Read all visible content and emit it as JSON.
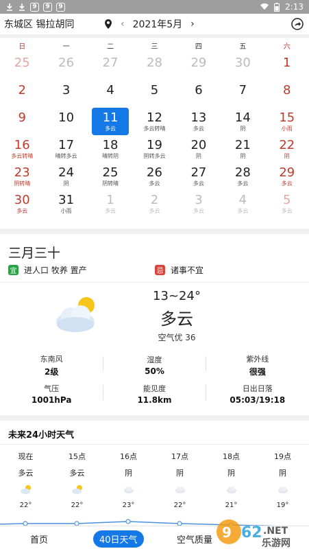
{
  "status_bar": {
    "time": "2:13",
    "badges": [
      "9",
      "9",
      "9"
    ],
    "icons": [
      "download-icon",
      "download-icon",
      "wifi-icon",
      "battery-icon"
    ]
  },
  "header": {
    "location": "东城区 锡拉胡同",
    "month": "2021年5月",
    "prev_icon": "chevron-left-icon",
    "next_icon": "chevron-right-icon",
    "share_icon": "share-icon"
  },
  "calendar": {
    "weekdays": [
      "日",
      "一",
      "二",
      "三",
      "四",
      "五",
      "六"
    ],
    "weeks": [
      [
        {
          "num": "25",
          "sub": "",
          "muted": true,
          "red": true
        },
        {
          "num": "26",
          "sub": "",
          "muted": true
        },
        {
          "num": "27",
          "sub": "",
          "muted": true
        },
        {
          "num": "28",
          "sub": "",
          "muted": true
        },
        {
          "num": "29",
          "sub": "",
          "muted": true
        },
        {
          "num": "30",
          "sub": "",
          "muted": true
        },
        {
          "num": "1",
          "sub": "",
          "red": true
        }
      ],
      [
        {
          "num": "2",
          "sub": "",
          "red": true
        },
        {
          "num": "3",
          "sub": ""
        },
        {
          "num": "4",
          "sub": ""
        },
        {
          "num": "5",
          "sub": ""
        },
        {
          "num": "6",
          "sub": ""
        },
        {
          "num": "7",
          "sub": ""
        },
        {
          "num": "8",
          "sub": "",
          "red": true
        }
      ],
      [
        {
          "num": "9",
          "sub": "",
          "red": true
        },
        {
          "num": "10",
          "sub": ""
        },
        {
          "num": "11",
          "sub": "多云",
          "selected": true
        },
        {
          "num": "12",
          "sub": "多云转晴"
        },
        {
          "num": "13",
          "sub": "多云"
        },
        {
          "num": "14",
          "sub": "阴"
        },
        {
          "num": "15",
          "sub": "小雨",
          "red": true
        }
      ],
      [
        {
          "num": "16",
          "sub": "多云转晴",
          "red": true
        },
        {
          "num": "17",
          "sub": "晴转多云"
        },
        {
          "num": "18",
          "sub": "晴转阴"
        },
        {
          "num": "19",
          "sub": "阴转多云"
        },
        {
          "num": "20",
          "sub": "阴"
        },
        {
          "num": "21",
          "sub": "阴"
        },
        {
          "num": "22",
          "sub": "阴",
          "red": true
        }
      ],
      [
        {
          "num": "23",
          "sub": "阴转晴",
          "red": true
        },
        {
          "num": "24",
          "sub": "阴"
        },
        {
          "num": "25",
          "sub": "阴转晴"
        },
        {
          "num": "26",
          "sub": "多云"
        },
        {
          "num": "27",
          "sub": "多云"
        },
        {
          "num": "28",
          "sub": "多云"
        },
        {
          "num": "29",
          "sub": "多云",
          "red": true
        }
      ],
      [
        {
          "num": "30",
          "sub": "多云",
          "red": true
        },
        {
          "num": "31",
          "sub": "小雨"
        },
        {
          "num": "1",
          "sub": "多云",
          "muted": true
        },
        {
          "num": "2",
          "sub": "多云",
          "muted": true
        },
        {
          "num": "3",
          "sub": "多云",
          "muted": true
        },
        {
          "num": "4",
          "sub": "多云",
          "muted": true
        },
        {
          "num": "5",
          "sub": "多云",
          "muted": true,
          "red": true
        }
      ]
    ]
  },
  "day_info": {
    "lunar_date": "三月三十",
    "yi_tag": "宜",
    "yi_text": "进人口 牧养 置产",
    "ji_tag": "忌",
    "ji_text": "诸事不宜",
    "temp_range": "13~24°",
    "condition": "多云",
    "air_quality": "空气优 36",
    "metrics": [
      {
        "label": "东南风",
        "value": "2级"
      },
      {
        "label": "湿度",
        "value": "50%"
      },
      {
        "label": "紫外线",
        "value": "很强"
      },
      {
        "label": "气压",
        "value": "1001hPa"
      },
      {
        "label": "能见度",
        "value": "11.8km"
      },
      {
        "label": "日出日落",
        "value": "05:03/19:18"
      }
    ]
  },
  "hourly": {
    "title": "未来24小时天气",
    "hours": [
      {
        "time": "现在",
        "cond": "多云",
        "icon": "partly-cloudy-icon",
        "temp": "22°"
      },
      {
        "time": "15点",
        "cond": "多云",
        "icon": "partly-cloudy-icon",
        "temp": "22°"
      },
      {
        "time": "16点",
        "cond": "阴",
        "icon": "cloud-icon",
        "temp": "23°"
      },
      {
        "time": "17点",
        "cond": "阴",
        "icon": "cloud-icon",
        "temp": "22°"
      },
      {
        "time": "18点",
        "cond": "阴",
        "icon": "cloud-icon",
        "temp": "21°"
      },
      {
        "time": "19点",
        "cond": "阴",
        "icon": "cloud-icon",
        "temp": "19°"
      }
    ]
  },
  "bottom_nav": {
    "home": "首页",
    "forecast40": "40日天气",
    "air": "空气质量"
  },
  "watermark": "962.NET 乐游网",
  "colors": {
    "accent": "#1478e6",
    "weekend_red": "#c0392b",
    "yi_green": "#2e9e48",
    "ji_red": "#d9453c"
  }
}
